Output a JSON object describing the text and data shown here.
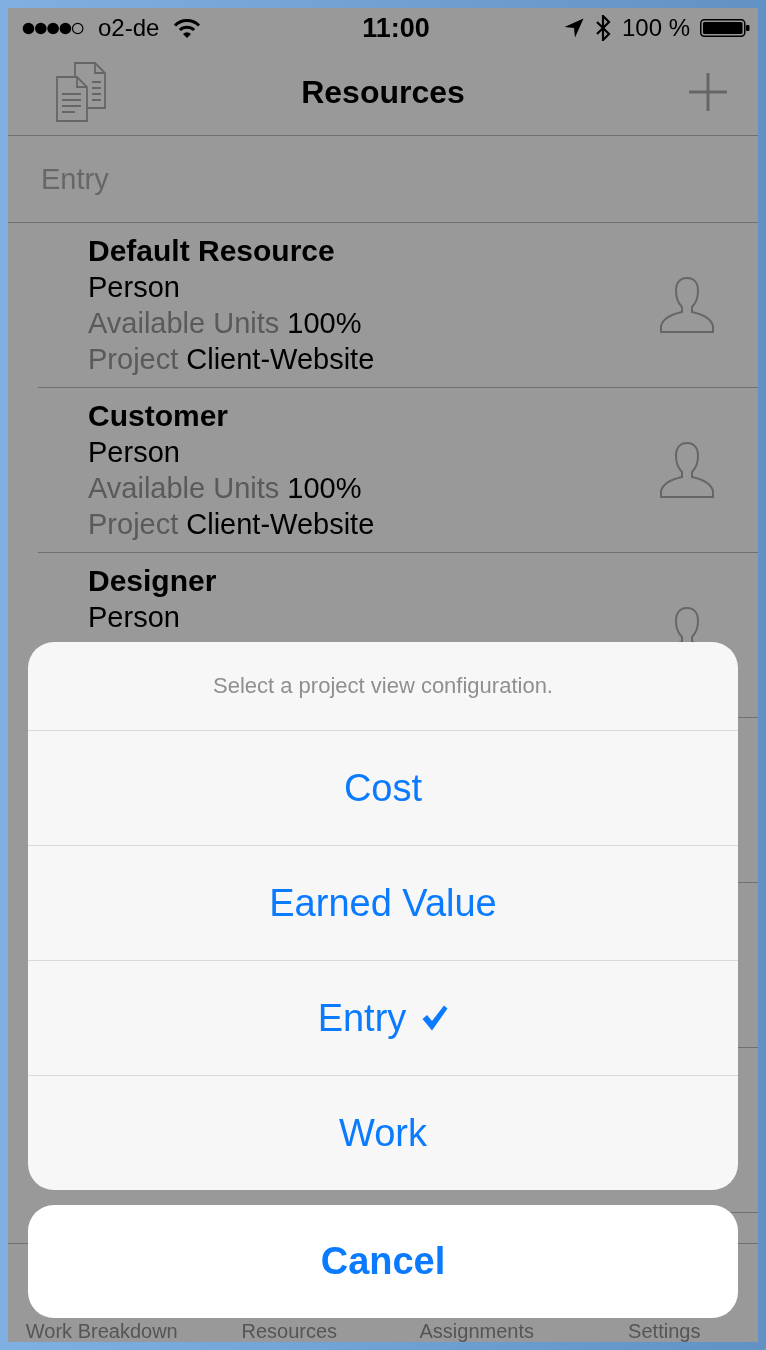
{
  "status_bar": {
    "carrier": "o2-de",
    "time": "11:00",
    "battery": "100 %"
  },
  "nav_bar": {
    "title": "Resources"
  },
  "section": {
    "title": "Entry"
  },
  "resources": [
    {
      "name": "Default Resource",
      "type": "Person",
      "units_label": "Available Units",
      "units": "100%",
      "project_label": "Project",
      "project": "Client-Website"
    },
    {
      "name": "Customer",
      "type": "Person",
      "units_label": "Available Units",
      "units": "100%",
      "project_label": "Project",
      "project": "Client-Website"
    },
    {
      "name": "Designer",
      "type": "Person"
    }
  ],
  "action_sheet": {
    "title": "Select a project view configuration.",
    "options": [
      {
        "label": "Cost",
        "selected": false
      },
      {
        "label": "Earned Value",
        "selected": false
      },
      {
        "label": "Entry",
        "selected": true
      },
      {
        "label": "Work",
        "selected": false
      }
    ],
    "cancel": "Cancel"
  },
  "tab_bar": {
    "items": [
      {
        "label": "Work Breakdown"
      },
      {
        "label": "Resources"
      },
      {
        "label": "Assignments"
      },
      {
        "label": "Settings"
      }
    ]
  }
}
